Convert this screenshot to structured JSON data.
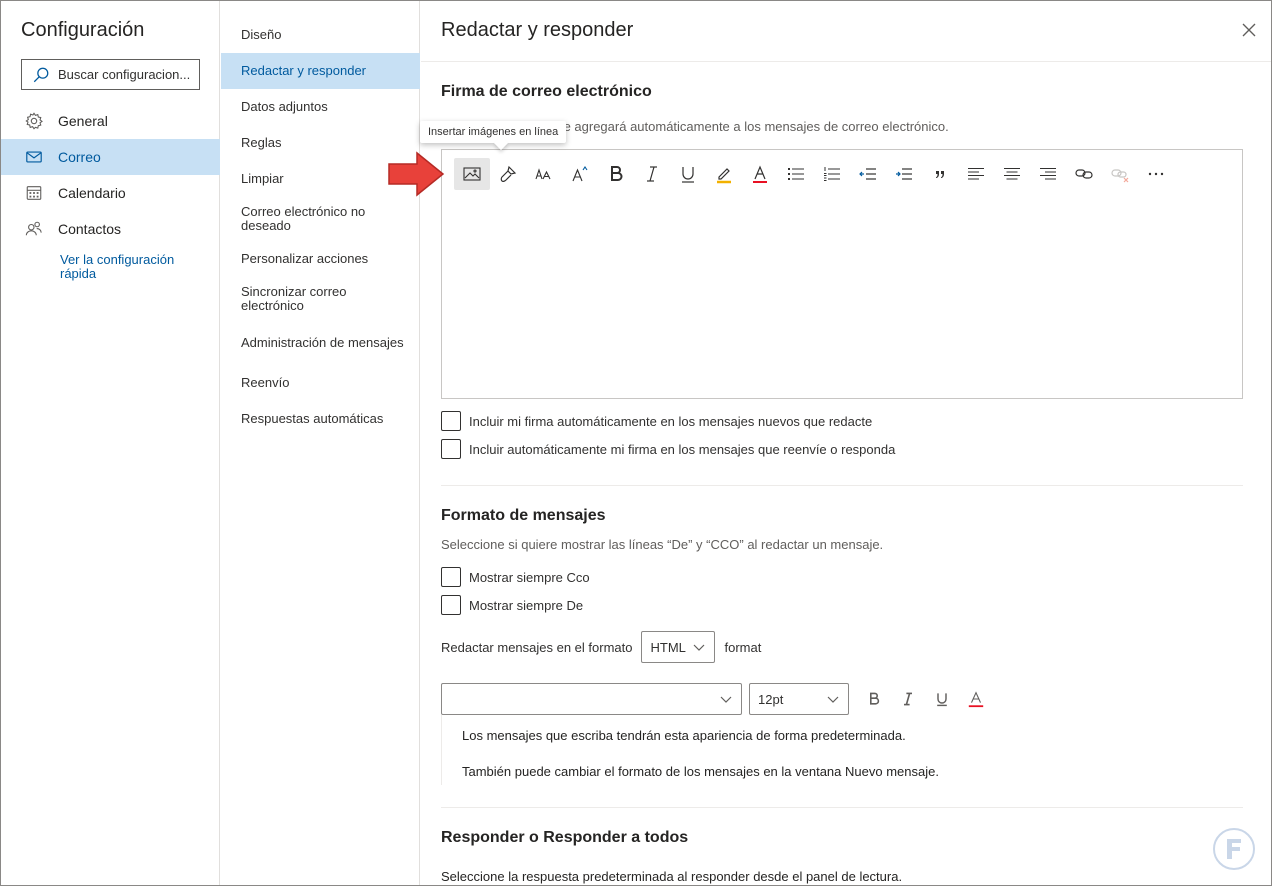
{
  "app": {
    "title": "Configuración"
  },
  "search": {
    "placeholder": "Buscar configuracion..."
  },
  "nav": {
    "items": [
      {
        "label": "General",
        "icon": "gear-icon"
      },
      {
        "label": "Correo",
        "icon": "mail-icon",
        "active": true
      },
      {
        "label": "Calendario",
        "icon": "calendar-icon"
      },
      {
        "label": "Contactos",
        "icon": "contacts-icon"
      }
    ],
    "quick_link": "Ver la configuración rápida"
  },
  "subnav": {
    "items": [
      {
        "label": "Diseño"
      },
      {
        "label": "Redactar y responder",
        "active": true
      },
      {
        "label": "Datos adjuntos"
      },
      {
        "label": "Reglas"
      },
      {
        "label": "Limpiar"
      },
      {
        "label": "Correo electrónico no deseado"
      },
      {
        "label": "Personalizar acciones"
      },
      {
        "label": "Sincronizar correo electrónico"
      },
      {
        "label": "Administración de mensajes"
      },
      {
        "label": "Reenvío"
      },
      {
        "label": "Respuestas automáticas"
      }
    ]
  },
  "page": {
    "title": "Redactar y responder"
  },
  "signature": {
    "title": "Firma de correo electrónico",
    "desc": "ue se agregará automáticamente a los mensajes de correo electrónico.",
    "tooltip": "Insertar imágenes en línea",
    "toolbar": [
      "insert-image-icon",
      "format-painter-icon",
      "font-size-icon",
      "grow-font-icon",
      "bold-icon",
      "italic-icon",
      "underline-icon",
      "highlight-icon",
      "font-color-icon",
      "bullets-icon",
      "numbering-icon",
      "decrease-indent-icon",
      "increase-indent-icon",
      "quote-icon",
      "align-left-icon",
      "align-center-icon",
      "align-right-icon",
      "link-icon",
      "remove-link-icon",
      "more-icon"
    ],
    "check1": "Incluir mi firma automáticamente en los mensajes nuevos que redacte",
    "check2": "Incluir automáticamente mi firma en los mensajes que reenvíe o responda"
  },
  "format": {
    "title": "Formato de mensajes",
    "desc": "Seleccione si quiere mostrar las líneas “De” y “CCO” al redactar un mensaje.",
    "check_cco": "Mostrar siempre Cco",
    "check_de": "Mostrar siempre De",
    "compose_label": "Redactar mensajes en el formato",
    "compose_value": "HTML",
    "compose_suffix": "format",
    "font_value": "",
    "size_value": "12pt",
    "preview1": "Los mensajes que escriba tendrán esta apariencia de forma predeterminada.",
    "preview2": "También puede cambiar el formato de los mensajes en la ventana Nuevo mensaje."
  },
  "reply": {
    "title": "Responder o Responder a todos",
    "desc": "Seleccione la respuesta predeterminada al responder desde el panel de lectura."
  },
  "colors": {
    "accent": "#005a9e",
    "selected_bg": "#c7e0f4",
    "arrow": "#e8413a"
  }
}
